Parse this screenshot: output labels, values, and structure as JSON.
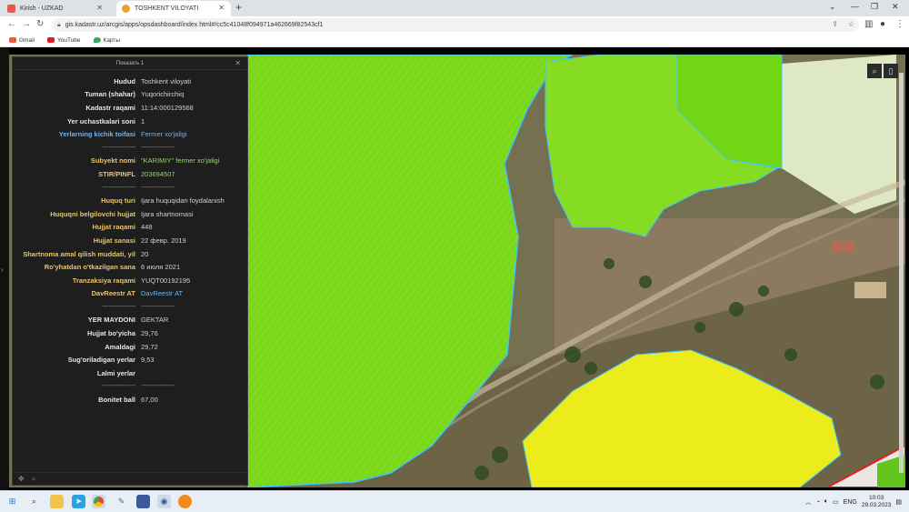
{
  "browser": {
    "tabs": [
      {
        "label": "Kirish - UZKAD",
        "active": false
      },
      {
        "label": "TOSHKENT VILOYATI",
        "active": true
      }
    ],
    "url": "gis.kadastr.uz/arcgis/apps/opsdashboard/index.html#/cc5c41048f094971a462669f82543cf1",
    "bookmarks": [
      "Gmail",
      "YouTube",
      "Карты"
    ]
  },
  "popup": {
    "title": "Показать 1",
    "rows": [
      {
        "key": "Hudud",
        "value": "Toshkent viloyati"
      },
      {
        "key": "Tuman (shahar)",
        "value": "Yuqorichirchiq"
      },
      {
        "key": "Kadastr raqami",
        "value": "11:14:000129568"
      },
      {
        "key": "Yer uchastkalari soni",
        "value": "1"
      },
      {
        "key": "Yerlarning kichik toifasi",
        "value": "Fermer xo'jaligi"
      }
    ],
    "rows2": [
      {
        "key": "Subyekt nomi",
        "value": "\"KARIMIY\" fermer xo'jaligi"
      },
      {
        "key": "STIR/PINFL",
        "value": "203694507"
      }
    ],
    "rows3": [
      {
        "key": "Huquq turi",
        "value": "Ijara huquqidan foydalanish"
      },
      {
        "key": "Huquqni belgilovchi hujjat",
        "value": "Ijara shartnomasi"
      },
      {
        "key": "Hujjat raqami",
        "value": "448"
      },
      {
        "key": "Hujjat sanasi",
        "value": "22 февр. 2019"
      },
      {
        "key": "Shartnoma amal qilish muddati, yil",
        "value": "20"
      },
      {
        "key": "Ro'yhatdan o'tkazilgan sana",
        "value": "6 июля 2021"
      },
      {
        "key": "Tranzaksiya raqami",
        "value": "YUQT00192195"
      },
      {
        "key": "DavReestr AT",
        "value": "DavReestr AT"
      }
    ],
    "rows4": [
      {
        "key": "YER MAYDONI",
        "value": "GEKTAR"
      },
      {
        "key": "Hujjat bo'yicha",
        "value": "29,76"
      },
      {
        "key": "Amaldagi",
        "value": "29,72"
      },
      {
        "key": "Sug'oriladigan yerlar",
        "value": "9,53"
      },
      {
        "key": "Lalmi yerlar",
        "value": ""
      }
    ],
    "rows5": [
      {
        "key": "Bonitet ball",
        "value": "67,00"
      }
    ],
    "separator": "--------------------"
  },
  "taskbar": {
    "lang": "ENG",
    "time": "10:03",
    "date": "29.03.2023"
  }
}
